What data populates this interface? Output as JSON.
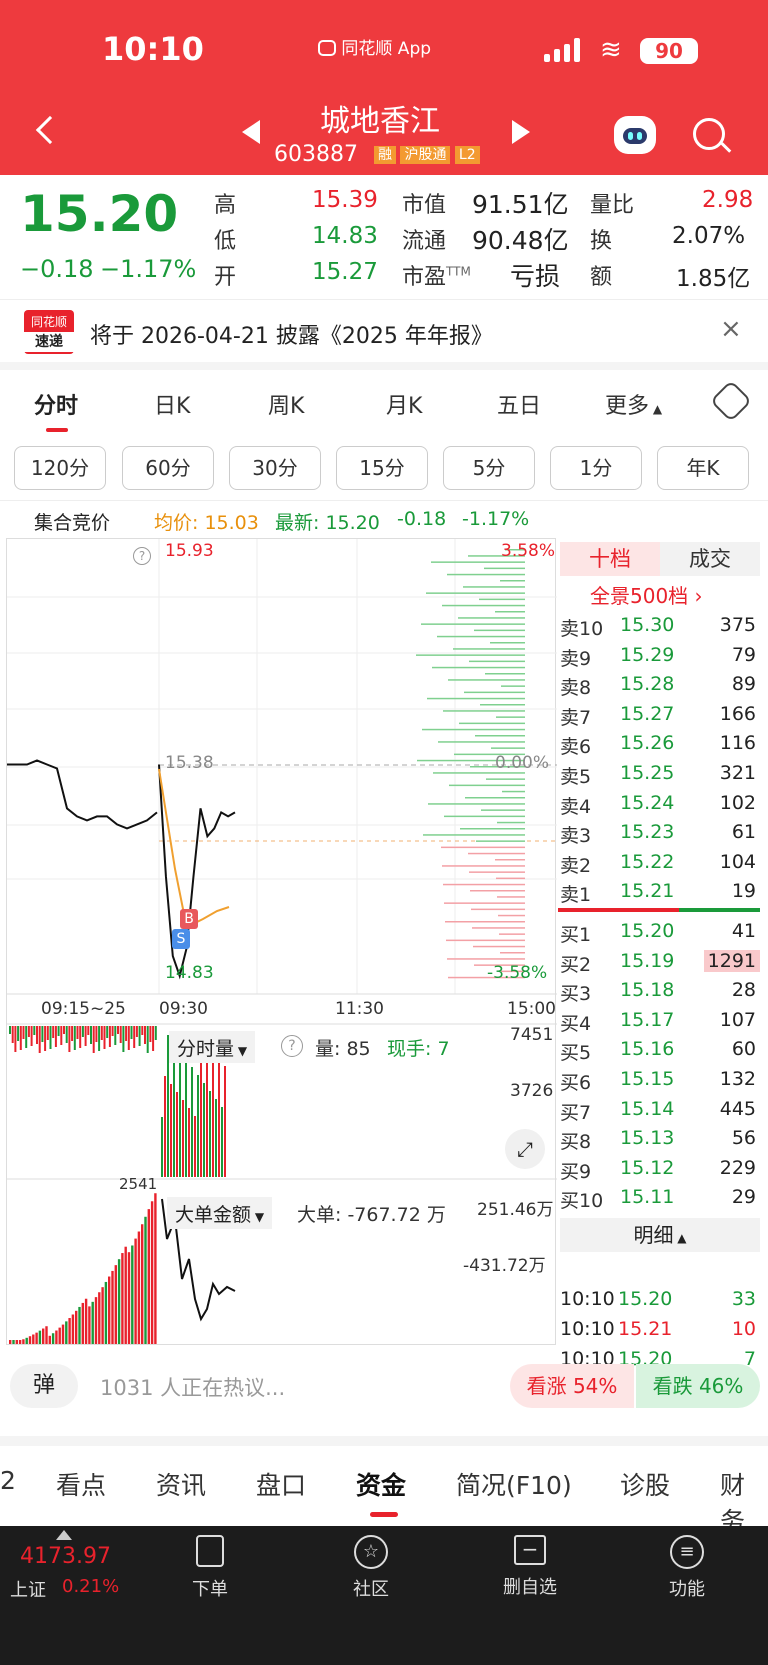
{
  "status_bar": {
    "time": "10:10",
    "app": "同花顺 App",
    "battery": "90"
  },
  "header": {
    "title": "城地香江",
    "code": "603887",
    "tags": [
      "融",
      "沪股通",
      "L2"
    ]
  },
  "quote": {
    "price": "15.20",
    "change": "−0.18",
    "change_pct": "−1.17%"
  },
  "stats": {
    "high_label": "高",
    "high": "15.39",
    "low_label": "低",
    "low": "14.83",
    "open_label": "开",
    "open": "15.27",
    "mktcap_label": "市值",
    "mktcap": "91.51亿",
    "float_label": "流通",
    "float": "90.48亿",
    "pe_label": "市盈",
    "pe_suffix": "TTM",
    "pe": "亏损",
    "volratio_label": "量比",
    "volratio": "2.98",
    "turnover_label": "换",
    "turnover": "2.07%",
    "amount_label": "额",
    "amount": "1.85亿"
  },
  "notice": {
    "logo_top": "同花顺",
    "logo_bottom": "速递",
    "text": "将于 2026-04-21 披露《2025 年年报》"
  },
  "chart_tabs": [
    "分时",
    "日K",
    "周K",
    "月K",
    "五日",
    "更多"
  ],
  "period_tabs": [
    "120分",
    "60分",
    "30分",
    "15分",
    "5分",
    "1分",
    "年K"
  ],
  "info_line": {
    "label": "集合竞价",
    "avg": "均价: 15.03",
    "latest": "最新: 15.20",
    "chg": "-0.18",
    "pct": "-1.17%"
  },
  "chart": {
    "y_high": "15.93",
    "y_mid": "15.38",
    "y_low": "14.83",
    "pct_high": "3.58%",
    "pct_mid": "0.00%",
    "pct_low": "-3.58%",
    "x_labels": [
      "09:15~25",
      "09:30",
      "11:30",
      "15:00"
    ],
    "marker_b": "B",
    "marker_s": "S",
    "vol_title": "分时量",
    "vol_label": "量: 85",
    "vol_hand": "现手: 7",
    "vol_max": "7451",
    "vol_mid": "3726",
    "big_title": "大单金额",
    "big_value": "大单: -767.72 万",
    "big_top": "251.46万",
    "big_mid": "-431.72万",
    "big_left": "2541"
  },
  "chart_data": {
    "type": "line",
    "title": "",
    "ylim": [
      14.83,
      15.93
    ],
    "series": [
      {
        "values": [
          15.38,
          15.38,
          15.38,
          15.39,
          15.38,
          15.37,
          15.27,
          15.25,
          15.24,
          15.25,
          15.25,
          15.23,
          15.22,
          15.23,
          15.24,
          15.26
        ]
      },
      {
        "values": [
          15.38,
          15.1,
          14.9,
          14.85,
          14.92,
          15.1,
          15.27,
          15.2,
          15.22,
          15.26,
          15.25,
          15.26
        ]
      }
    ]
  },
  "orderbook": {
    "tab_active": "十档",
    "tab_other": "成交",
    "all": "全景500档 ›",
    "sells": [
      {
        "label": "卖10",
        "price": "15.30",
        "vol": "375"
      },
      {
        "label": "卖9",
        "price": "15.29",
        "vol": "79"
      },
      {
        "label": "卖8",
        "price": "15.28",
        "vol": "89"
      },
      {
        "label": "卖7",
        "price": "15.27",
        "vol": "166"
      },
      {
        "label": "卖6",
        "price": "15.26",
        "vol": "116"
      },
      {
        "label": "卖5",
        "price": "15.25",
        "vol": "321"
      },
      {
        "label": "卖4",
        "price": "15.24",
        "vol": "102"
      },
      {
        "label": "卖3",
        "price": "15.23",
        "vol": "61"
      },
      {
        "label": "卖2",
        "price": "15.22",
        "vol": "104"
      },
      {
        "label": "卖1",
        "price": "15.21",
        "vol": "19"
      }
    ],
    "buys": [
      {
        "label": "买1",
        "price": "15.20",
        "vol": "41"
      },
      {
        "label": "买2",
        "price": "15.19",
        "vol": "1291"
      },
      {
        "label": "买3",
        "price": "15.18",
        "vol": "28"
      },
      {
        "label": "买4",
        "price": "15.17",
        "vol": "107"
      },
      {
        "label": "买5",
        "price": "15.16",
        "vol": "60"
      },
      {
        "label": "买6",
        "price": "15.15",
        "vol": "132"
      },
      {
        "label": "买7",
        "price": "15.14",
        "vol": "445"
      },
      {
        "label": "买8",
        "price": "15.13",
        "vol": "56"
      },
      {
        "label": "买9",
        "price": "15.12",
        "vol": "229"
      },
      {
        "label": "买10",
        "price": "15.11",
        "vol": "29"
      }
    ],
    "detail_title": "明细",
    "trades": [
      {
        "time": "10:10",
        "price": "15.20",
        "vol": "33"
      },
      {
        "time": "10:10",
        "price": "15.21",
        "vol": "10"
      },
      {
        "time": "10:10",
        "price": "15.20",
        "vol": "7"
      }
    ]
  },
  "discussion": {
    "bullet": "弹",
    "text": "1031 人正在热议...",
    "up": "看涨 54%",
    "down": "看跌 46%"
  },
  "bottom_tabs": [
    "2",
    "看点",
    "资讯",
    "盘口",
    "资金",
    "简况(F10)",
    "诊股",
    "财务"
  ],
  "nav": {
    "index_value": "4173.97",
    "index_name": "上证",
    "index_pct": "0.21%",
    "items": [
      "下单",
      "社区",
      "删自选",
      "功能"
    ]
  }
}
